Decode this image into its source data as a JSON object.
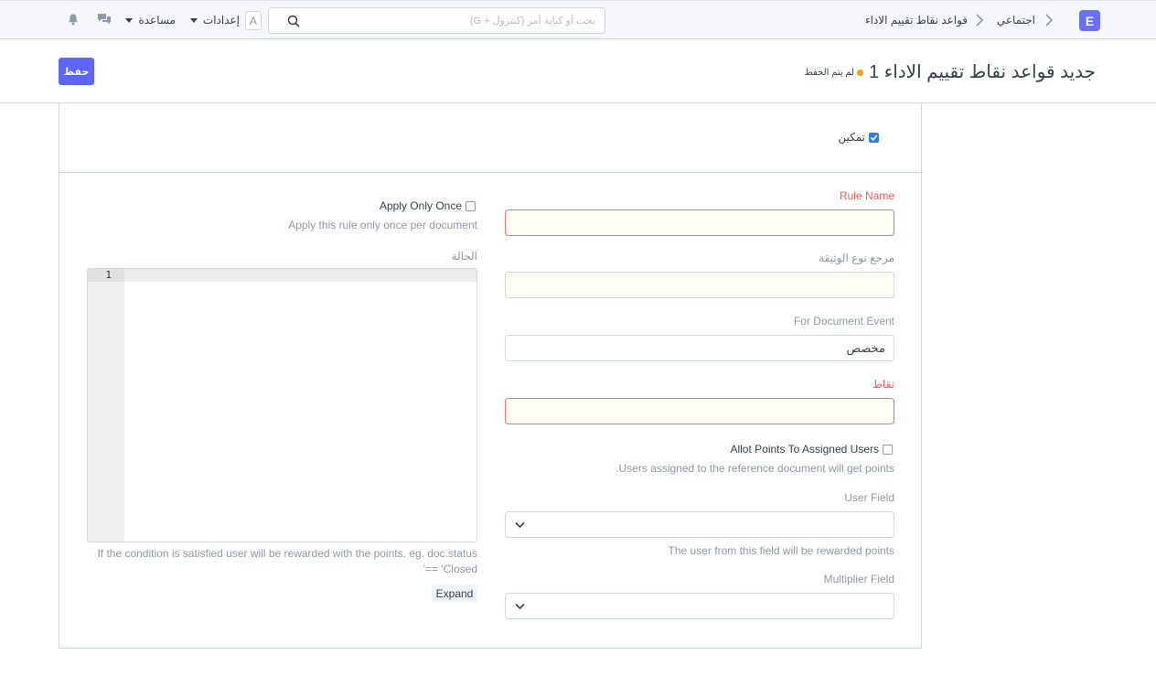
{
  "navbar": {
    "logo_letter": "E",
    "breadcrumbs": [
      "اجتماعي",
      "قواعد نقاط تقييم الاداء"
    ],
    "search_placeholder": "بحث أو كتابة أمر (كنترول + G)",
    "avatar_letter": "A",
    "settings_label": "إعدادات",
    "help_label": "مساعدة",
    "icons": [
      "chevron-right-icon",
      "search-icon",
      "caret-down-icon",
      "chat-icon",
      "bell-icon"
    ]
  },
  "page_header": {
    "title": "جديد قواعد نقاط تقييم الاداء 1",
    "indicator": "لم يتم الحفظ",
    "save_label": "حفظ"
  },
  "form": {
    "enabled": {
      "label": "تمكين",
      "checked": true
    },
    "rule_name": {
      "label": "Rule Name",
      "value": ""
    },
    "reference_doctype": {
      "label": "مرجع نوع الوثيقة",
      "value": ""
    },
    "document_event": {
      "label": "For Document Event",
      "value": "مخصص"
    },
    "points": {
      "label": "نقاط",
      "value": ""
    },
    "allot_points": {
      "label": "Allot Points To Assigned Users",
      "checked": false,
      "description": "Users assigned to the reference document will get points."
    },
    "user_field": {
      "label": "User Field",
      "value": "",
      "description": "The user from this field will be rewarded points"
    },
    "multiplier_field": {
      "label": "Multiplier Field",
      "value": ""
    },
    "apply_only_once": {
      "label": "Apply Only Once",
      "checked": false,
      "description": "Apply this rule only once per document"
    },
    "condition": {
      "label": "الحالة",
      "line_numbers": [
        "1"
      ],
      "description": "If the condition is satisfied user will be rewarded with the points. eg. doc.status == 'Closed'",
      "expand_label": "Expand"
    }
  },
  "colors": {
    "primary": "#5e64ff",
    "logo": "#6a6ff7",
    "indicator_orange": "#ffa00a",
    "required_red": "#ff5858",
    "checkbox_blue": "#2f80ed"
  }
}
